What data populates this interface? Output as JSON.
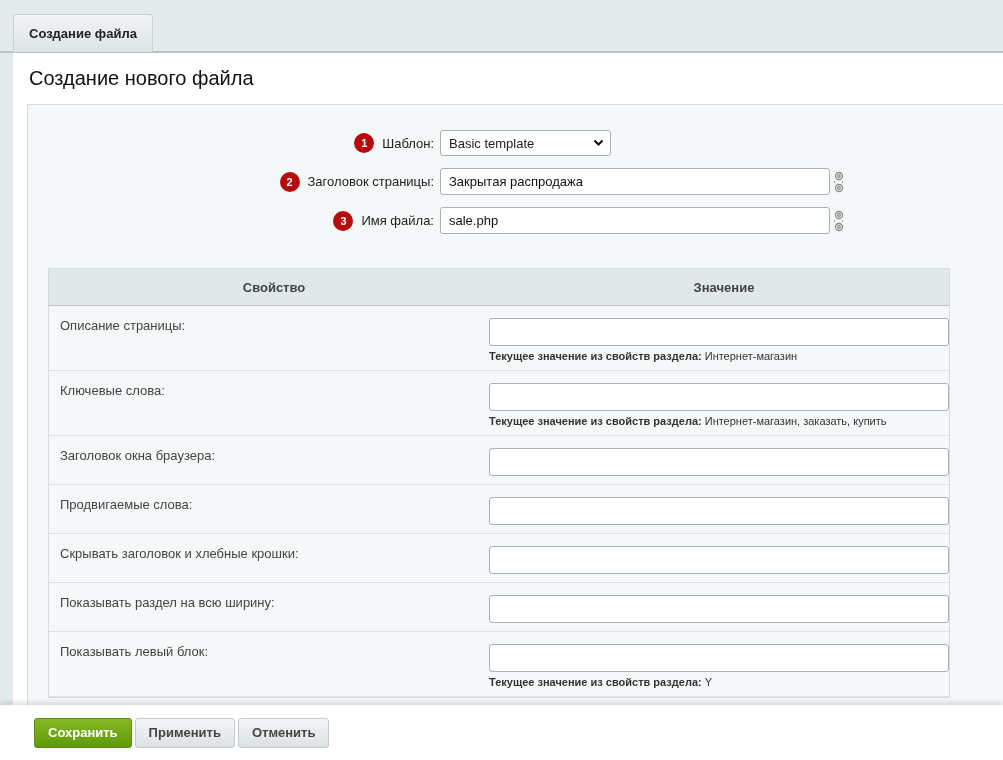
{
  "tabs": [
    {
      "label": "Создание файла"
    }
  ],
  "heading": "Создание нового файла",
  "form_fields": [
    {
      "badge": "1",
      "label": "Шаблон:",
      "kind": "select",
      "value": "Basic template",
      "pin": false
    },
    {
      "badge": "2",
      "label": "Заголовок страницы:",
      "kind": "text",
      "value": "Закрытая распродажа",
      "pin": true
    },
    {
      "badge": "3",
      "label": "Имя файла:",
      "kind": "text",
      "value": "sale.php",
      "pin": true
    }
  ],
  "table": {
    "columns": [
      "Свойство",
      "Значение"
    ],
    "rows": [
      {
        "label": "Описание страницы:",
        "hint": "**Текущее значение из свойств раздела:** Интернет-магазин"
      },
      {
        "label": "Ключевые слова:",
        "hint": "**Текущее значение из свойств раздела:** Интернет-магазин, заказать, купить"
      },
      {
        "label": "Заголовок окна браузера:"
      },
      {
        "label": "Продвигаемые слова:"
      },
      {
        "label": "Скрывать заголовок и хлебные крошки:"
      },
      {
        "label": "Показывать раздел на всю ширину:"
      },
      {
        "label": "Показывать левый блок:",
        "hint": "**Текущее значение из свойств раздела:** Y"
      }
    ]
  },
  "buttons": [
    {
      "label": "Сохранить",
      "kind": "primary"
    },
    {
      "label": "Применить",
      "kind": "secondary"
    },
    {
      "label": "Отменить",
      "kind": "secondary"
    }
  ]
}
